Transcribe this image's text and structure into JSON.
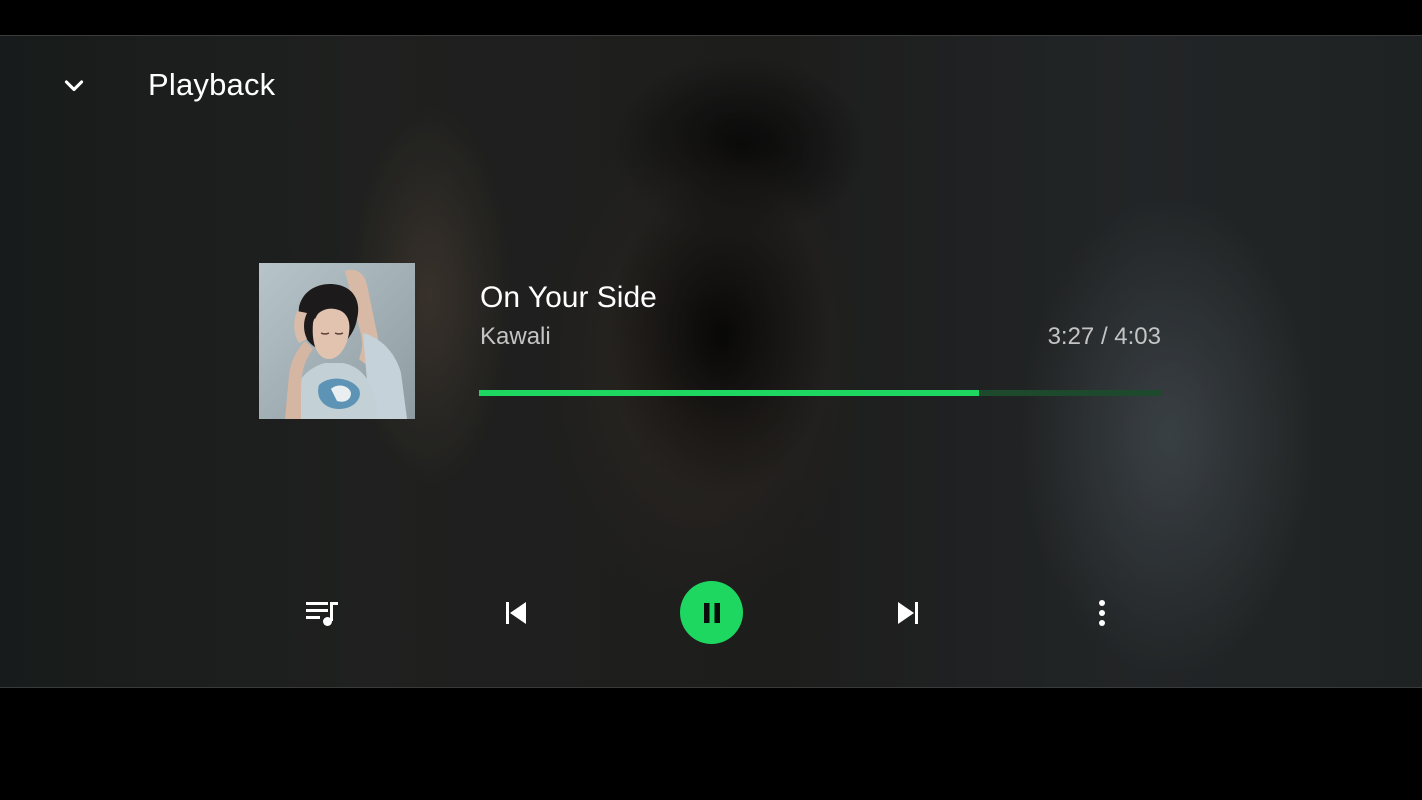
{
  "header": {
    "title": "Playback",
    "back_icon": "chevron-down-icon"
  },
  "track": {
    "title": "On Your Side",
    "artist": "Kawali",
    "time_display": "3:27 / 4:03",
    "progress_fraction": 0.732
  },
  "controls": {
    "queue_icon": "queue-music-icon",
    "previous_icon": "skip-previous-icon",
    "play_pause_icon": "pause-icon",
    "next_icon": "skip-next-icon",
    "more_icon": "more-vertical-icon"
  },
  "colors": {
    "accent": "#1ed760",
    "progress_track": "#1d4a2c",
    "text_primary": "#ffffff",
    "text_secondary": "#c4c4c4"
  }
}
